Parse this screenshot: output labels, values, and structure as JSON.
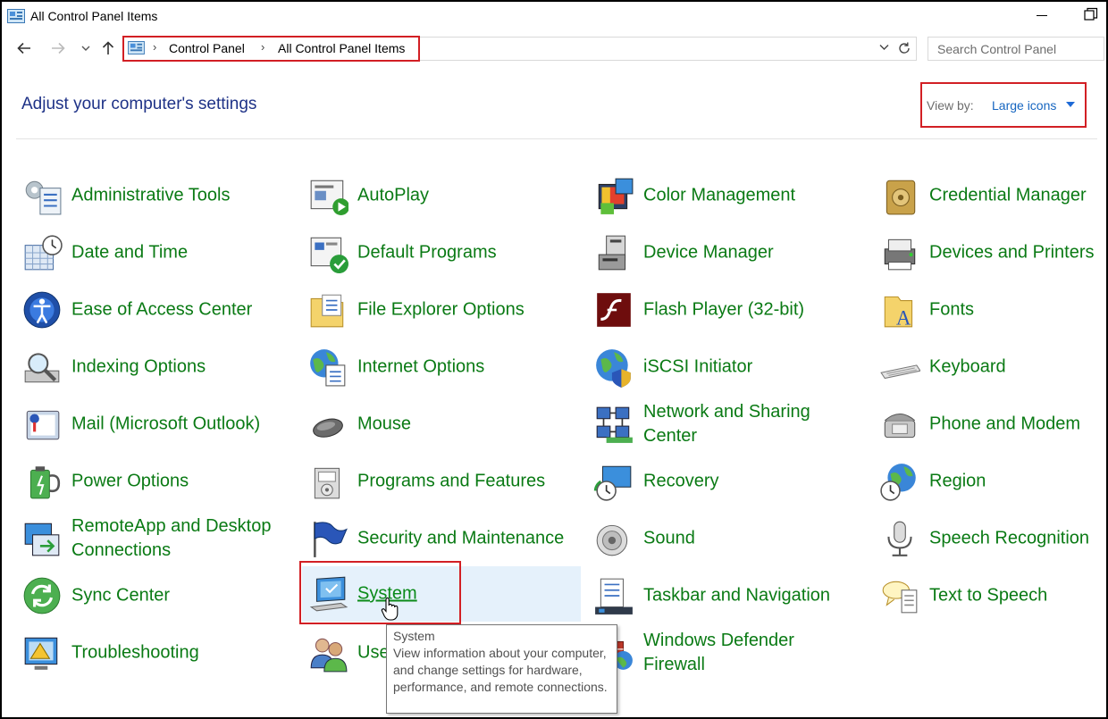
{
  "window": {
    "title": "All Control Panel Items"
  },
  "address": {
    "crumbs": [
      "Control Panel",
      "All Control Panel Items"
    ],
    "search_placeholder": "Search Control Panel"
  },
  "header": {
    "title": "Adjust your computer's settings",
    "view_by_label": "View by:",
    "view_by_value": "Large icons"
  },
  "items": [
    {
      "label": "Administrative Tools",
      "icon": "admin-tools-icon"
    },
    {
      "label": "AutoPlay",
      "icon": "autoplay-icon"
    },
    {
      "label": "Color Management",
      "icon": "color-management-icon"
    },
    {
      "label": "Credential Manager",
      "icon": "credential-manager-icon"
    },
    {
      "label": "Date and Time",
      "icon": "date-time-icon"
    },
    {
      "label": "Default Programs",
      "icon": "default-programs-icon"
    },
    {
      "label": "Device Manager",
      "icon": "device-manager-icon"
    },
    {
      "label": "Devices and Printers",
      "icon": "devices-printers-icon"
    },
    {
      "label": "Ease of Access Center",
      "icon": "ease-of-access-icon"
    },
    {
      "label": "File Explorer Options",
      "icon": "file-explorer-options-icon"
    },
    {
      "label": "Flash Player (32-bit)",
      "icon": "flash-player-icon"
    },
    {
      "label": "Fonts",
      "icon": "fonts-icon"
    },
    {
      "label": "Indexing Options",
      "icon": "indexing-options-icon"
    },
    {
      "label": "Internet Options",
      "icon": "internet-options-icon"
    },
    {
      "label": "iSCSI Initiator",
      "icon": "iscsi-initiator-icon"
    },
    {
      "label": "Keyboard",
      "icon": "keyboard-icon"
    },
    {
      "label": "Mail (Microsoft Outlook)",
      "icon": "mail-icon"
    },
    {
      "label": "Mouse",
      "icon": "mouse-icon"
    },
    {
      "label": "Network and Sharing\nCenter",
      "icon": "network-sharing-icon"
    },
    {
      "label": "Phone and Modem",
      "icon": "phone-modem-icon"
    },
    {
      "label": "Power Options",
      "icon": "power-options-icon"
    },
    {
      "label": "Programs and Features",
      "icon": "programs-features-icon"
    },
    {
      "label": "Recovery",
      "icon": "recovery-icon"
    },
    {
      "label": "Region",
      "icon": "region-icon"
    },
    {
      "label": "RemoteApp and Desktop\nConnections",
      "icon": "remoteapp-icon"
    },
    {
      "label": "Security and Maintenance",
      "icon": "security-maintenance-icon"
    },
    {
      "label": "Sound",
      "icon": "sound-icon"
    },
    {
      "label": "Speech Recognition",
      "icon": "speech-recognition-icon"
    },
    {
      "label": "Sync Center",
      "icon": "sync-center-icon"
    },
    {
      "label": "System",
      "icon": "system-icon"
    },
    {
      "label": "Taskbar and Navigation",
      "icon": "taskbar-navigation-icon"
    },
    {
      "label": "Text to Speech",
      "icon": "text-to-speech-icon"
    },
    {
      "label": "Troubleshooting",
      "icon": "troubleshooting-icon"
    },
    {
      "label": "Use",
      "icon": "user-accounts-icon"
    },
    {
      "label": "Windows Defender\nFirewall",
      "icon": "firewall-icon"
    }
  ],
  "tooltip": {
    "title": "System",
    "text": "View information about your computer, and change settings for hardware, performance, and remote connections."
  }
}
